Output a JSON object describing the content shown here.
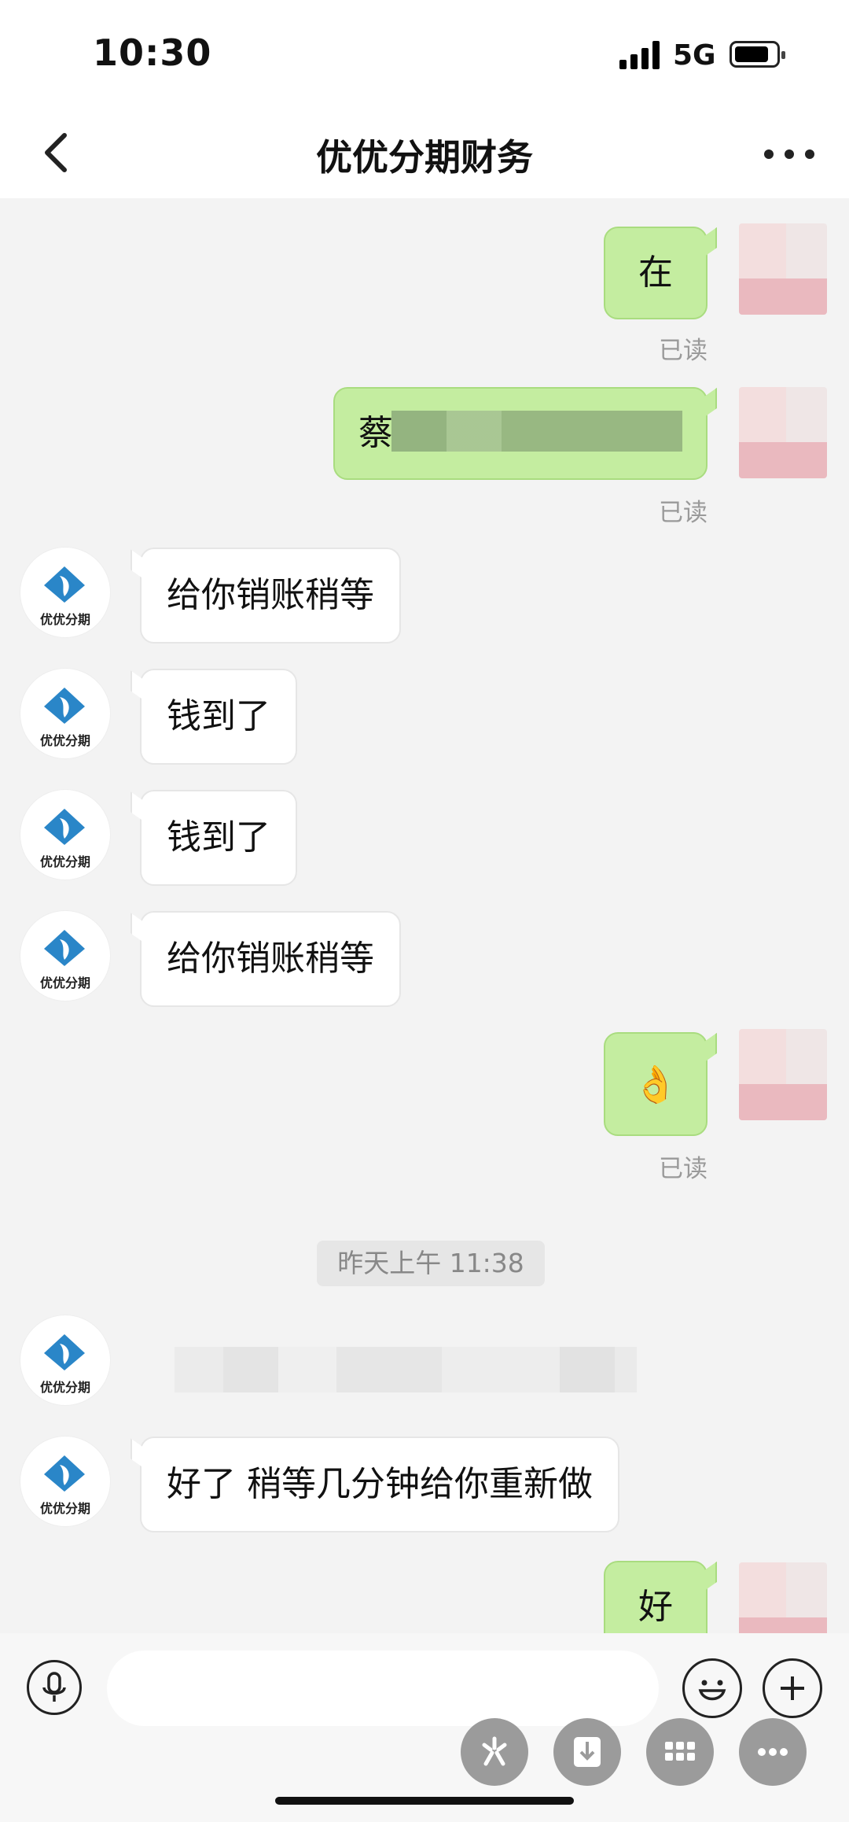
{
  "status_bar": {
    "time": "10:30",
    "network": "5G"
  },
  "nav": {
    "title": "优优分期财务"
  },
  "avatar_text": "优优分期",
  "messages": {
    "m1": {
      "text": "在",
      "status": "已读"
    },
    "m2": {
      "text": "蔡",
      "status": "已读"
    },
    "m3": {
      "text": "给你销账稍等"
    },
    "m4": {
      "text": "钱到了"
    },
    "m5": {
      "text": "钱到了"
    },
    "m6": {
      "text": "给你销账稍等"
    },
    "m7": {
      "text": "👌",
      "status": "已读"
    },
    "m8": {
      "text": "好了 稍等几分钟给你重新做"
    },
    "m9": {
      "text": "好"
    }
  },
  "timestamp": "昨天上午 11:38",
  "icons": {
    "back": "chevron-left-icon",
    "more": "more-dots-icon",
    "mic": "microphone-icon",
    "emoji": "smiley-icon",
    "plus": "plus-icon"
  },
  "colors": {
    "sent_bubble": "#c4eda0",
    "received_bubble": "#ffffff",
    "background": "#f3f3f3",
    "logo_blue": "#2a86c8"
  }
}
